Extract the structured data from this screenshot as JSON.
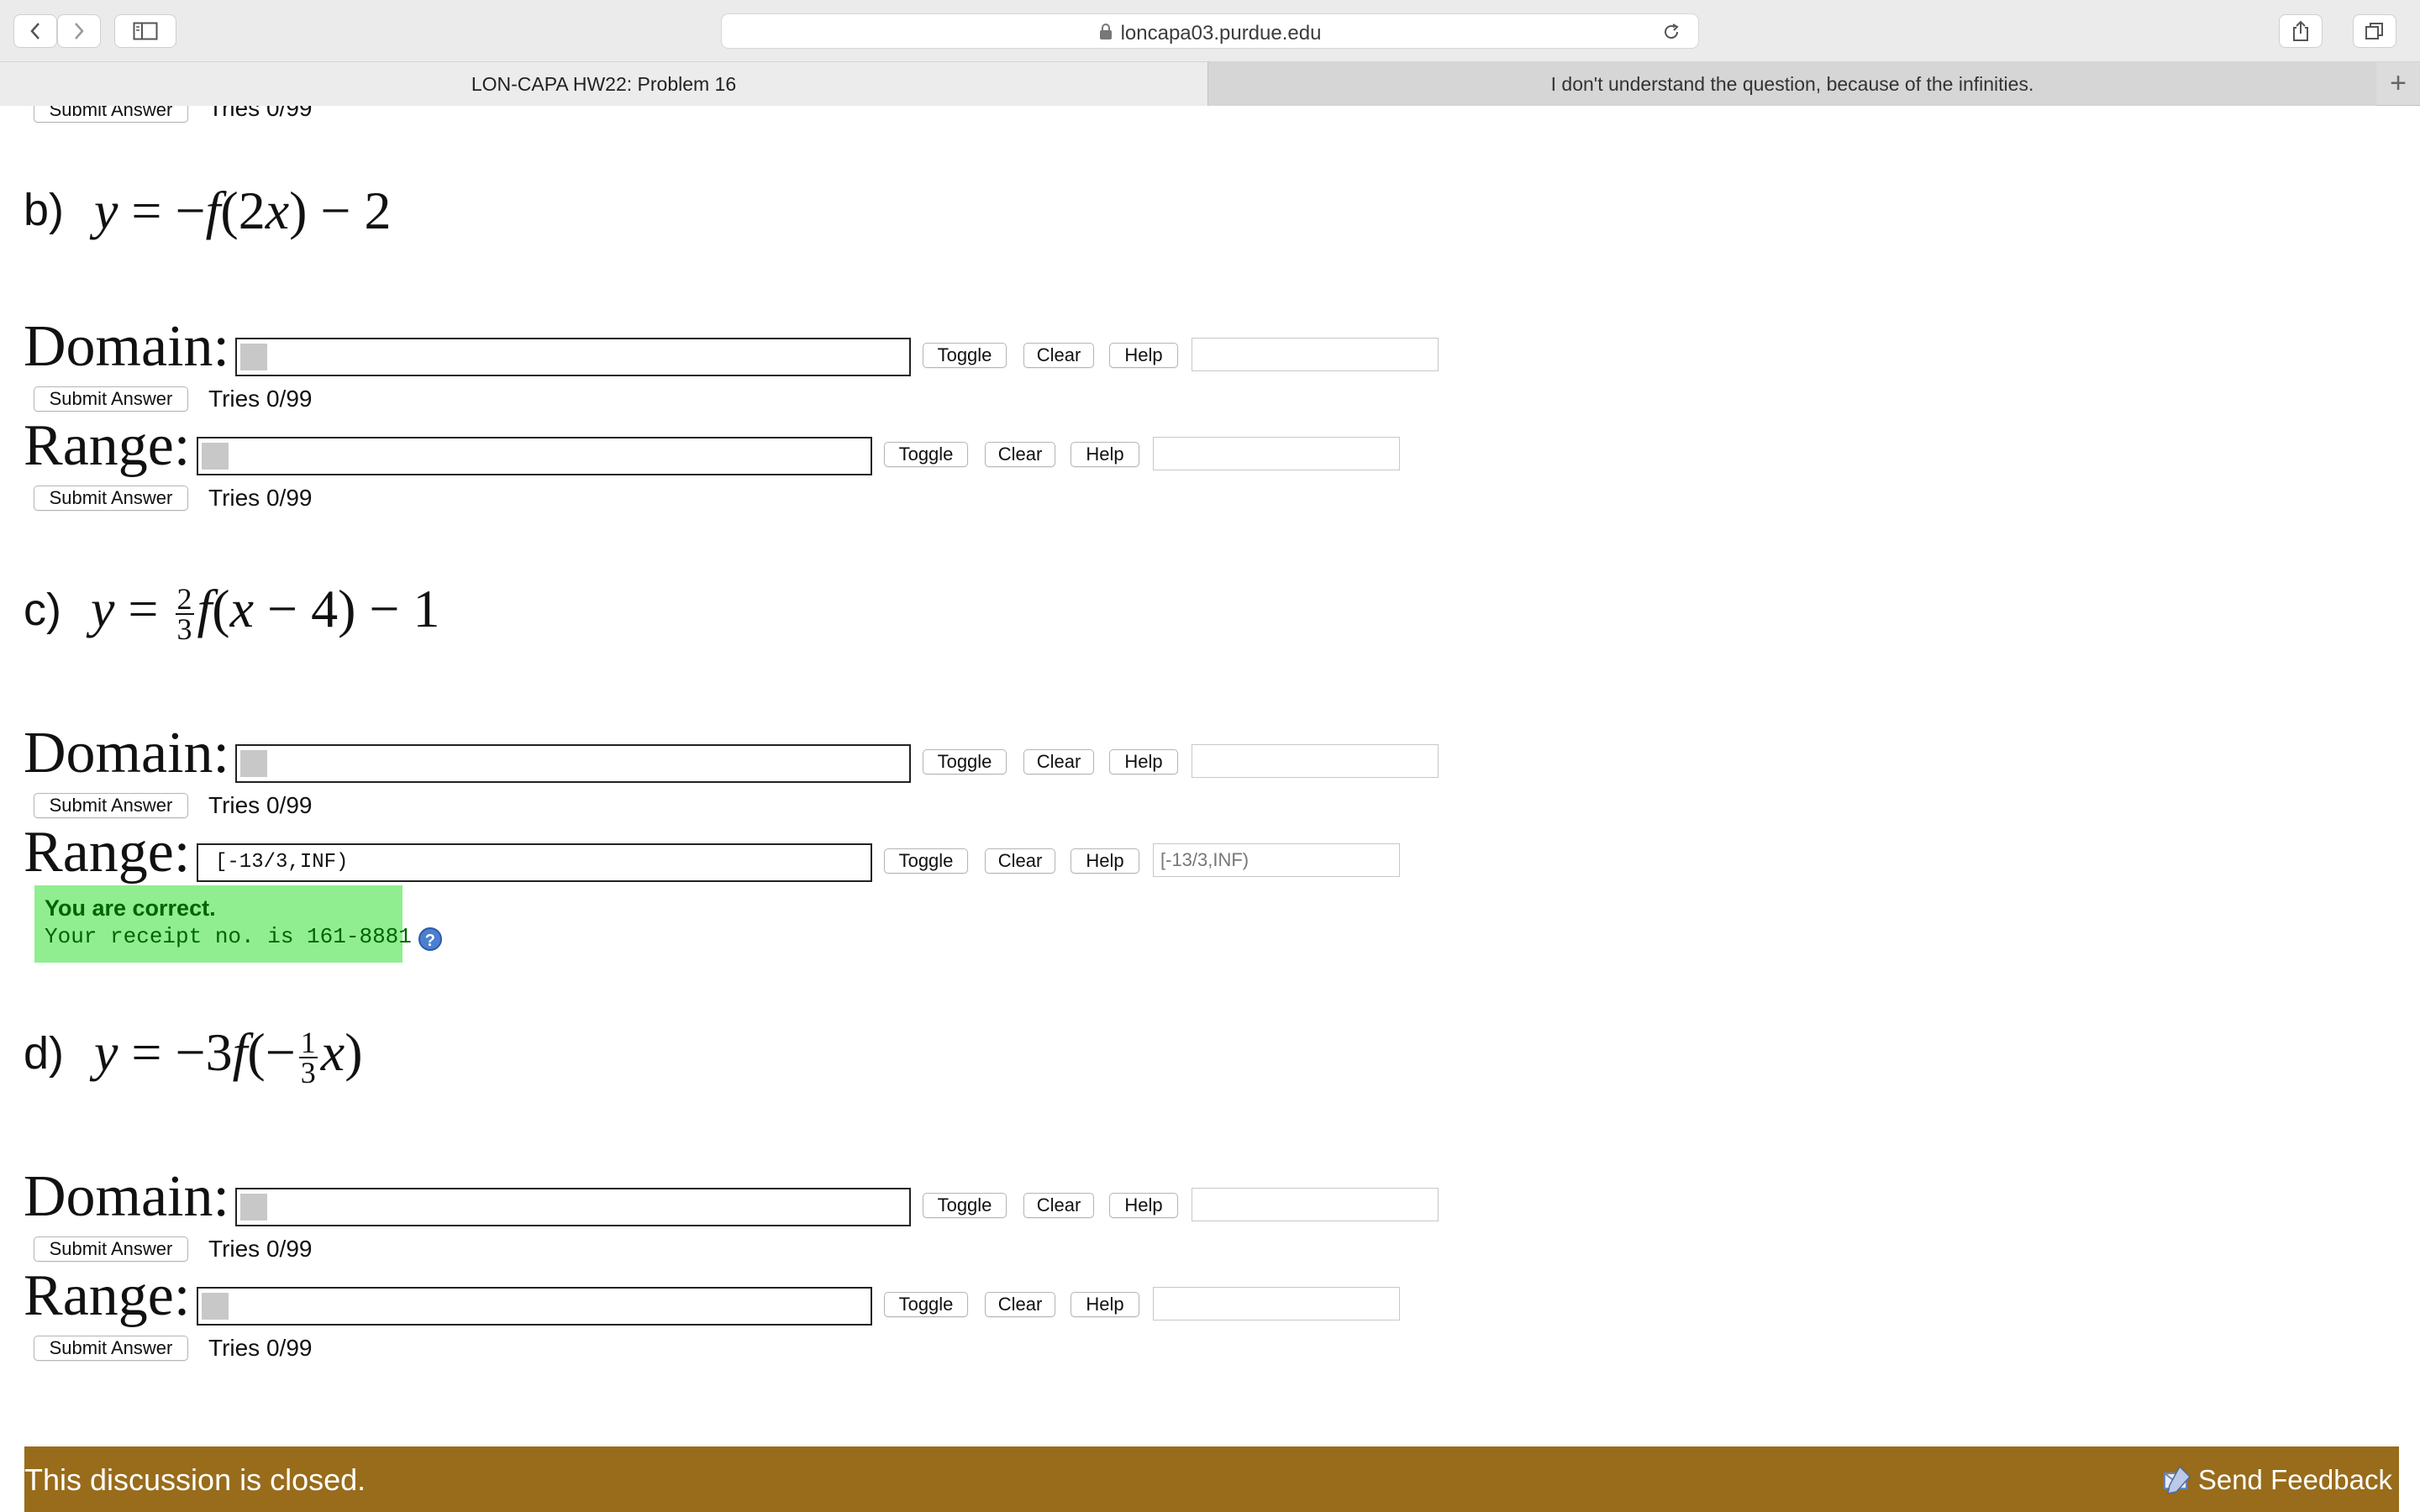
{
  "browser": {
    "url": "loncapa03.purdue.edu",
    "tabs": [
      {
        "label": "LON-CAPA HW22: Problem 16",
        "active": true
      },
      {
        "label": "I don't understand the question, because of the infinities.",
        "active": false
      }
    ],
    "new_tab": "+"
  },
  "top_partial": {
    "submit_label": "Submit Answer",
    "tries": "Tries 0/99"
  },
  "buttons": {
    "toggle": "Toggle",
    "clear": "Clear",
    "help": "Help",
    "submit": "Submit Answer"
  },
  "labels": {
    "domain": "Domain:",
    "range": "Range:"
  },
  "parts": [
    {
      "letter": "b)",
      "formula": "y = −f(2x) − 2",
      "domain": {
        "value": "",
        "preview": "",
        "tries": "Tries 0/99"
      },
      "range": {
        "value": "",
        "preview": "",
        "tries": "Tries 0/99"
      }
    },
    {
      "letter": "c)",
      "formula": "y = (2/3)f(x − 4) − 1",
      "frac": {
        "num": "2",
        "den": "3"
      },
      "domain": {
        "value": "",
        "preview": "",
        "tries": "Tries 0/99"
      },
      "range": {
        "value": "[-13/3,INF)",
        "preview": "[-13/3,INF)",
        "result_title": "You are correct.",
        "receipt": "Your receipt no. is 161-8881"
      }
    },
    {
      "letter": "d)",
      "formula": "y = −3f(−(1/3)x)",
      "frac": {
        "num": "1",
        "den": "3"
      },
      "domain": {
        "value": "",
        "preview": "",
        "tries": "Tries 0/99"
      },
      "range": {
        "value": "",
        "preview": "",
        "tries": "Tries 0/99"
      }
    }
  ],
  "help_icon": "?",
  "footer": {
    "text": "This discussion is closed.",
    "feedback": "Send Feedback"
  },
  "icons": [
    "back-icon",
    "forward-icon",
    "sidebar-icon",
    "lock-icon",
    "reload-icon",
    "share-icon",
    "tabs-overview-icon",
    "help-circle-icon",
    "feedback-icon"
  ],
  "colors": {
    "correct_bg": "#90ee90",
    "correct_text": "#006400",
    "footer_bg": "#986c1a"
  }
}
